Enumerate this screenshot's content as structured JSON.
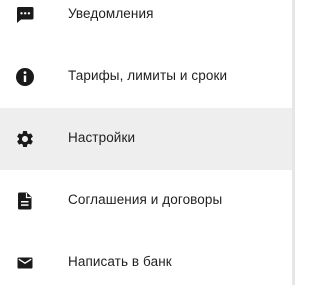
{
  "menu": {
    "items": [
      {
        "icon": "message-icon",
        "label": "Уведомления",
        "active": false
      },
      {
        "icon": "info-icon",
        "label": "Тарифы, лимиты и сроки",
        "active": false
      },
      {
        "icon": "gear-icon",
        "label": "Настройки",
        "active": true
      },
      {
        "icon": "document-icon",
        "label": "Соглашения и договоры",
        "active": false
      },
      {
        "icon": "mail-icon",
        "label": "Написать в банк",
        "active": false
      }
    ]
  },
  "colors": {
    "active_background": "#eeeeee",
    "icon": "#1a1a1a",
    "text": "#1f1f1f"
  }
}
